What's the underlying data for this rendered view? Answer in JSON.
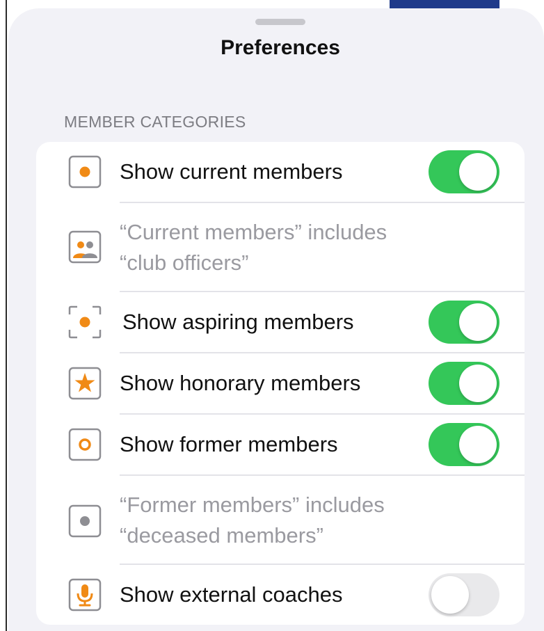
{
  "sheet": {
    "title": "Preferences",
    "section_header": "MEMBER CATEGORIES"
  },
  "rows": [
    {
      "label": "Show current members",
      "icon": "square-dot-icon",
      "toggle": true
    },
    {
      "note_line1": "“Current members” includes",
      "note_line2": "“club officers”",
      "icon": "people-icon"
    },
    {
      "label": "Show aspiring members",
      "icon": "viewfinder-dot-icon",
      "toggle": true
    },
    {
      "label": "Show honorary members",
      "icon": "star-icon",
      "toggle": true
    },
    {
      "label": "Show former members",
      "icon": "ring-icon",
      "toggle": true
    },
    {
      "note_line1": "“Former members” includes",
      "note_line2": "“deceased members”",
      "icon": "gray-dot-icon"
    },
    {
      "label": "Show external coaches",
      "icon": "microphone-icon",
      "toggle": false
    }
  ],
  "colors": {
    "accent": "#f08a16",
    "toggle_on": "#34c759",
    "toggle_off": "#e9e9eb",
    "background": "#f2f2f7"
  }
}
